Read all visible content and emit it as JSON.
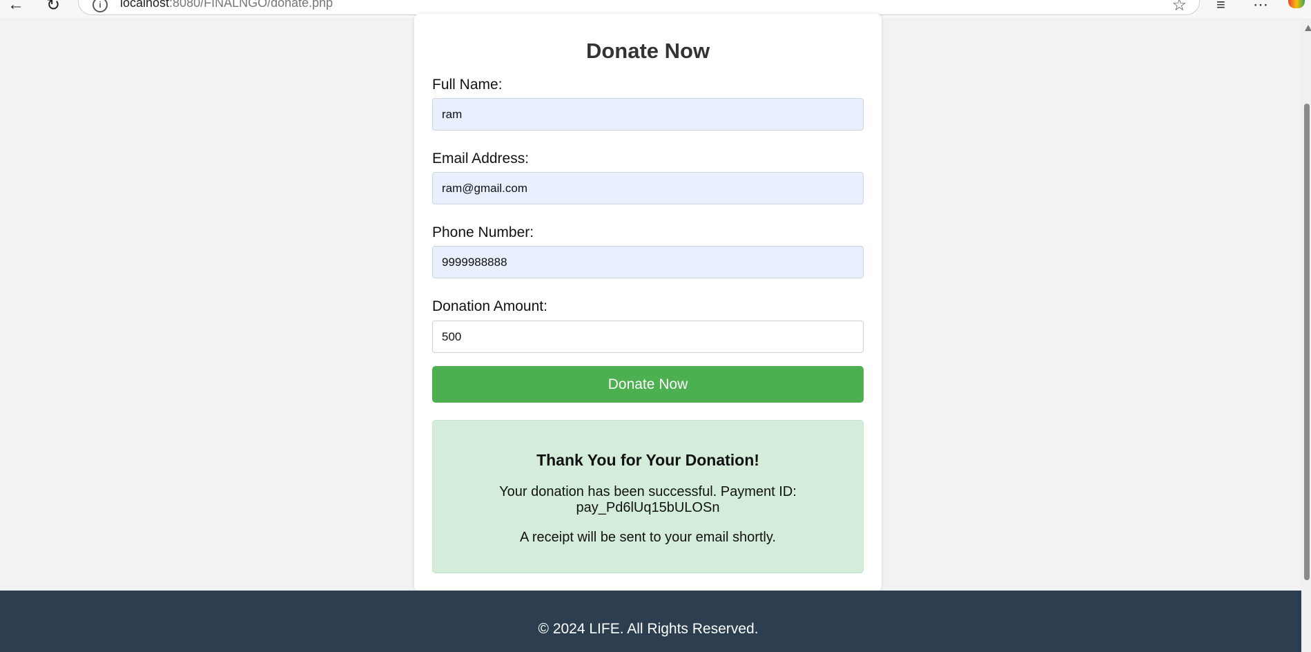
{
  "browser": {
    "url_host": "localhost",
    "url_rest": ":8080/FINALNGO/donate.php"
  },
  "form": {
    "title": "Donate Now",
    "full_name": {
      "label": "Full Name:",
      "value": "ram"
    },
    "email": {
      "label": "Email Address:",
      "value": "ram@gmail.com"
    },
    "phone": {
      "label": "Phone Number:",
      "value": "9999988888"
    },
    "amount": {
      "label": "Donation Amount:",
      "value": "500"
    },
    "submit_label": "Donate Now"
  },
  "success": {
    "title": "Thank You for Your Donation!",
    "message": "Your donation has been successful. Payment ID: pay_Pd6lUq15bULOSn",
    "receipt_note": "A receipt will be sent to your email shortly."
  },
  "footer": {
    "text": "© 2024 LIFE. All Rights Reserved."
  },
  "colors": {
    "accent": "#4caf50",
    "footer_bg": "#2c3e50",
    "success_bg": "#d4edda",
    "autofill_bg": "#e8f0fe"
  }
}
